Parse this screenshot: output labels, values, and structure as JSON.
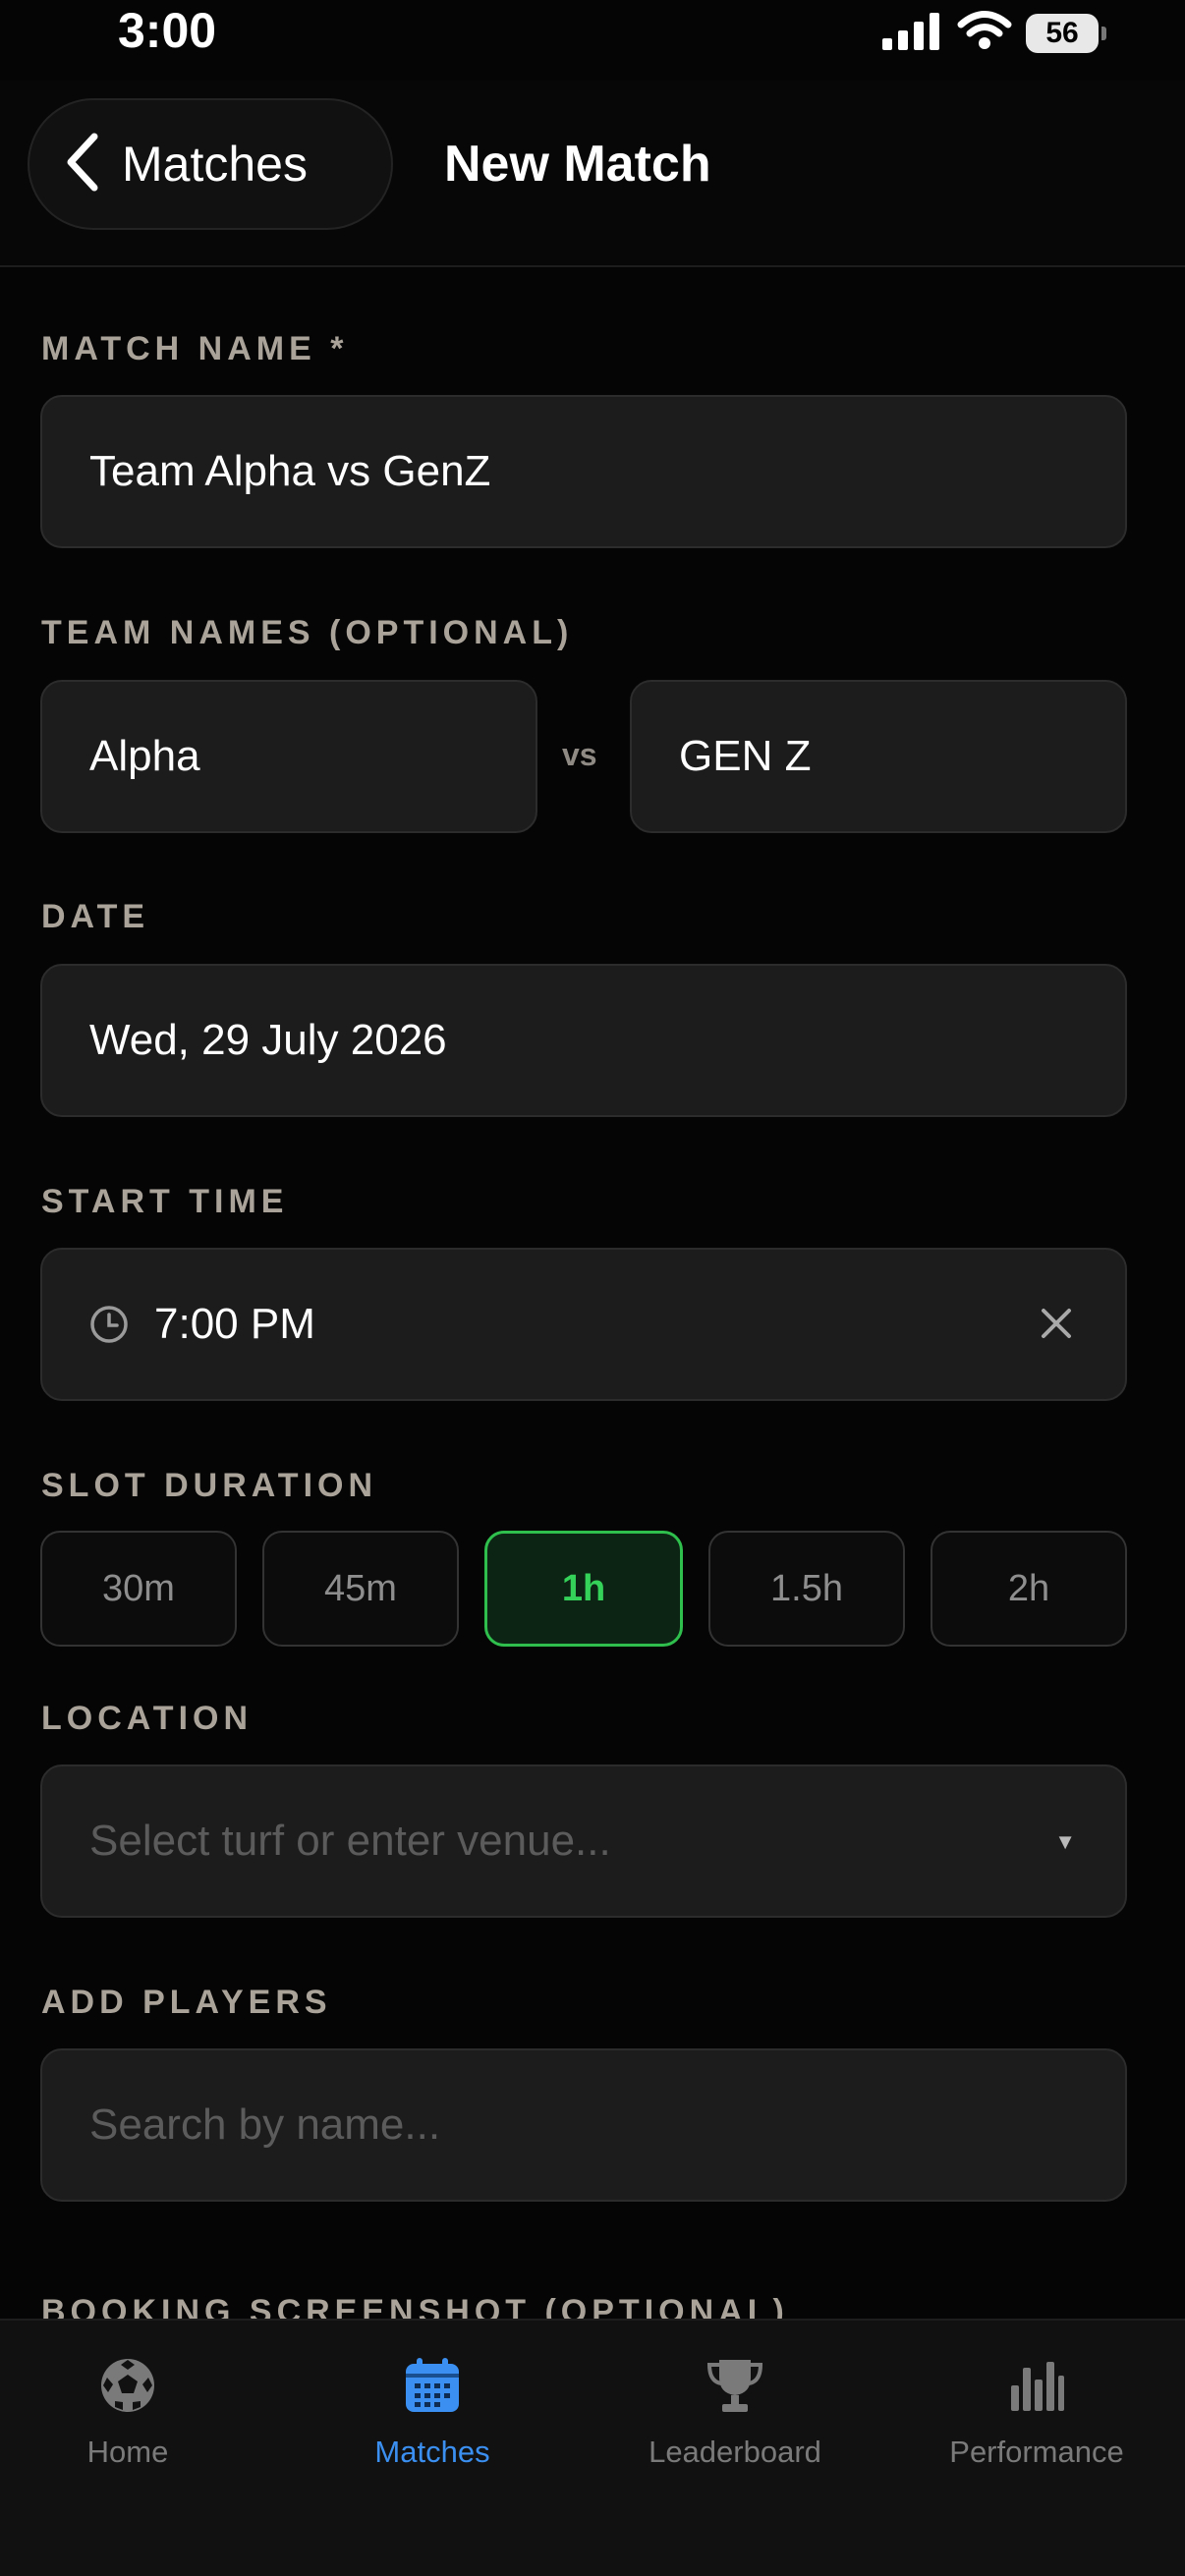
{
  "status_bar": {
    "time": "3:00",
    "battery": "56"
  },
  "header": {
    "back_label": "Matches",
    "title": "New Match"
  },
  "form": {
    "match_name": {
      "label": "MATCH NAME *",
      "value": "Team Alpha vs GenZ"
    },
    "team_names": {
      "label": "TEAM NAMES (OPTIONAL)",
      "team_a": "Alpha",
      "vs": "vs",
      "team_b": "GEN Z"
    },
    "date": {
      "label": "DATE",
      "value": "Wed, 29 July 2026"
    },
    "start_time": {
      "label": "START TIME",
      "value": "7:00 PM"
    },
    "slot_duration": {
      "label": "SLOT DURATION",
      "options": [
        "30m",
        "45m",
        "1h",
        "1.5h",
        "2h"
      ],
      "selected": "1h"
    },
    "location": {
      "label": "LOCATION",
      "placeholder": "Select turf or enter venue..."
    },
    "add_players": {
      "label": "ADD PLAYERS",
      "placeholder": "Search by name..."
    },
    "booking_screenshot": {
      "label": "BOOKING SCREENSHOT (OPTIONAL)"
    }
  },
  "tab_bar": {
    "tabs": [
      {
        "label": "Home",
        "icon": "soccer-ball-icon",
        "active": false
      },
      {
        "label": "Matches",
        "icon": "calendar-icon",
        "active": true
      },
      {
        "label": "Leaderboard",
        "icon": "trophy-icon",
        "active": false
      },
      {
        "label": "Performance",
        "icon": "bar-chart-icon",
        "active": false
      }
    ]
  },
  "colors": {
    "accent_green": "#35d25a",
    "accent_blue": "#3b8ff0",
    "background": "#050505",
    "field_background": "#1c1c1c",
    "label_color": "#aaa39a"
  }
}
